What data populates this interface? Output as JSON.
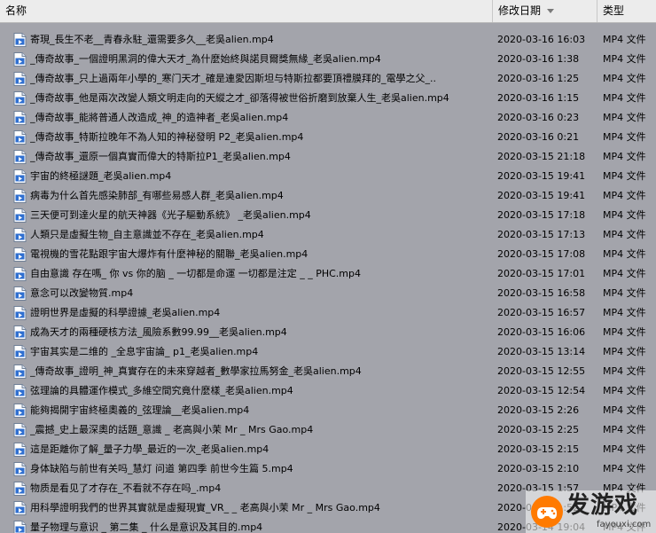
{
  "header": {
    "name_label": "名称",
    "date_label": "修改日期",
    "type_label": "类型"
  },
  "files": [
    {
      "name": "寄現_長生不老__青春永駐_還需要多久__老吳alien.mp4",
      "date": "2020-03-16 16:03",
      "type": "MP4 文件"
    },
    {
      "name": "_傳奇故事_一個證明黑洞的偉大天才_為什麼始終與諾貝爾獎無緣_老吳alien.mp4",
      "date": "2020-03-16 1:38",
      "type": "MP4 文件"
    },
    {
      "name": "_傳奇故事_只上過兩年小學的_寒门天才_確是連愛因斯坦与特斯拉都要頂禮膜拜的_電學之父_..",
      "date": "2020-03-16 1:25",
      "type": "MP4 文件"
    },
    {
      "name": "_傳奇故事_他是兩次改變人類文明走向的天縱之才_卻落得被世俗折磨到放棄人生_老吳alien.mp4",
      "date": "2020-03-16 1:15",
      "type": "MP4 文件"
    },
    {
      "name": "_傳奇故事_能將普通人改造成_神_的造神者_老吳alien.mp4",
      "date": "2020-03-16 0:23",
      "type": "MP4 文件"
    },
    {
      "name": "_傳奇故事_特斯拉晚年不為人知的神秘發明 P2_老吳alien.mp4",
      "date": "2020-03-16 0:21",
      "type": "MP4 文件"
    },
    {
      "name": "_傳奇故事_還原一個真實而偉大的特斯拉P1_老吳alien.mp4",
      "date": "2020-03-15 21:18",
      "type": "MP4 文件"
    },
    {
      "name": "宇宙的終極謎題_老吳alien.mp4",
      "date": "2020-03-15 19:41",
      "type": "MP4 文件"
    },
    {
      "name": "病毒为什么首先感染肺部_有哪些易感人群_老吳alien.mp4",
      "date": "2020-03-15 19:41",
      "type": "MP4 文件"
    },
    {
      "name": "三天便可到達火星的航天神器《光子驅動系統》 _老吳alien.mp4",
      "date": "2020-03-15 17:18",
      "type": "MP4 文件"
    },
    {
      "name": "人類只是虛擬生物_自主意識並不存在_老吳alien.mp4",
      "date": "2020-03-15 17:13",
      "type": "MP4 文件"
    },
    {
      "name": "電視機的雪花點跟宇宙大爆炸有什麼神秘的關聯_老吳alien.mp4",
      "date": "2020-03-15 17:08",
      "type": "MP4 文件"
    },
    {
      "name": "自由意識 存在嗎_ 你 vs 你的脑 _ 一切都是命運 一切都是注定 _ _ PHC.mp4",
      "date": "2020-03-15 17:01",
      "type": "MP4 文件"
    },
    {
      "name": "意念可以改變物質.mp4",
      "date": "2020-03-15 16:58",
      "type": "MP4 文件"
    },
    {
      "name": "證明世界是虛擬的科學證據_老吳alien.mp4",
      "date": "2020-03-15 16:57",
      "type": "MP4 文件"
    },
    {
      "name": "成為天才的兩種硬核方法_風險系數99.99__老吳alien.mp4",
      "date": "2020-03-15 16:06",
      "type": "MP4 文件"
    },
    {
      "name": "宇宙其实是二维的 _全息宇宙論_ p1_老吳alien.mp4",
      "date": "2020-03-15 13:14",
      "type": "MP4 文件"
    },
    {
      "name": "_傳奇故事_證明_神_真實存在的未來穿越者_數學家拉馬努金_老吳alien.mp4",
      "date": "2020-03-15 12:55",
      "type": "MP4 文件"
    },
    {
      "name": "弦理論的具體運作模式_多維空間究竟什麼樣_老吳alien.mp4",
      "date": "2020-03-15 12:54",
      "type": "MP4 文件"
    },
    {
      "name": "能夠揭開宇宙終極奧義的_弦理論__老吳alien.mp4",
      "date": "2020-03-15 2:26",
      "type": "MP4 文件"
    },
    {
      "name": "_震撼_史上最深奧的話題_意識 _ 老高與小茉 Mr _ Mrs Gao.mp4",
      "date": "2020-03-15 2:25",
      "type": "MP4 文件"
    },
    {
      "name": "這是距離你了解_量子力學_最近的一次_老吳alien.mp4",
      "date": "2020-03-15 2:15",
      "type": "MP4 文件"
    },
    {
      "name": "身体缺陷与前世有关吗_慧灯 问道 第四季 前世今生篇 5.mp4",
      "date": "2020-03-15 2:10",
      "type": "MP4 文件"
    },
    {
      "name": "物质是看见了才存在_不看就不存在吗_.mp4",
      "date": "2020-03-15 1:57",
      "type": "MP4 文件"
    },
    {
      "name": "用科學證明我們的世界其實就是虛擬現實_VR_ _ 老高與小茉 Mr _ Mrs Gao.mp4",
      "date": "2020-03-15 1:52",
      "type": "MP4 文件"
    },
    {
      "name": "量子物理与意识 _ 第二集 _ 什么是意识及其目的.mp4",
      "date": "2020-03-14 19:04",
      "type": "MP4 文件"
    }
  ],
  "watermark": {
    "text": "发游戏",
    "url": "fayouxi.com"
  }
}
